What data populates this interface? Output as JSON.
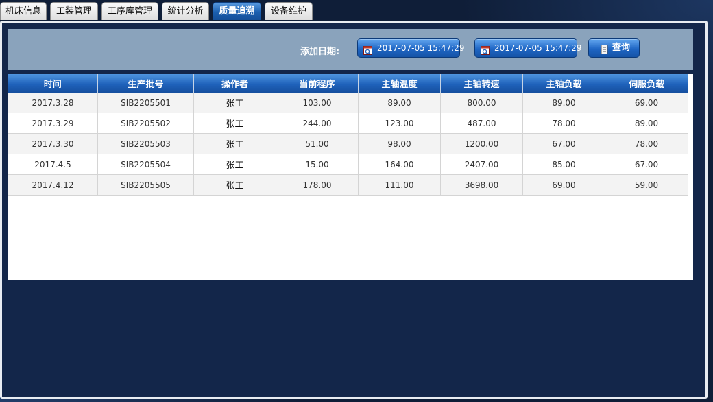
{
  "tabs": [
    {
      "label": "机床信息",
      "active": false
    },
    {
      "label": "工装管理",
      "active": false
    },
    {
      "label": "工序库管理",
      "active": false
    },
    {
      "label": "统计分析",
      "active": false
    },
    {
      "label": "质量追溯",
      "active": true
    },
    {
      "label": "设备维护",
      "active": false
    }
  ],
  "filter": {
    "label": "添加日期:",
    "start_date": "2017-07-05 15:47:29",
    "end_date": "2017-07-05 15:47:29",
    "query_label": "查询"
  },
  "table": {
    "columns": [
      "时间",
      "生产批号",
      "操作者",
      "当前程序",
      "主轴温度",
      "主轴转速",
      "主轴负载",
      "伺服负载"
    ],
    "rows": [
      [
        "2017.3.28",
        "SIB2205501",
        "张工",
        "103.00",
        "89.00",
        "800.00",
        "89.00",
        "69.00"
      ],
      [
        "2017.3.29",
        "SIB2205502",
        "张工",
        "244.00",
        "123.00",
        "487.00",
        "78.00",
        "89.00"
      ],
      [
        "2017.3.30",
        "SIB2205503",
        "张工",
        "51.00",
        "98.00",
        "1200.00",
        "67.00",
        "78.00"
      ],
      [
        "2017.4.5",
        "SIB2205504",
        "张工",
        "15.00",
        "164.00",
        "2407.00",
        "85.00",
        "67.00"
      ],
      [
        "2017.4.12",
        "SIB2205505",
        "张工",
        "178.00",
        "111.00",
        "3698.00",
        "69.00",
        "59.00"
      ]
    ]
  },
  "icons": {
    "date_picker": "calendar-icon",
    "query": "document-icon"
  },
  "colors": {
    "background": "#13264a",
    "filter_bar": "#8aa3bc",
    "header_blue": "#1f62bb",
    "active_tab": "#1b5fb0"
  }
}
